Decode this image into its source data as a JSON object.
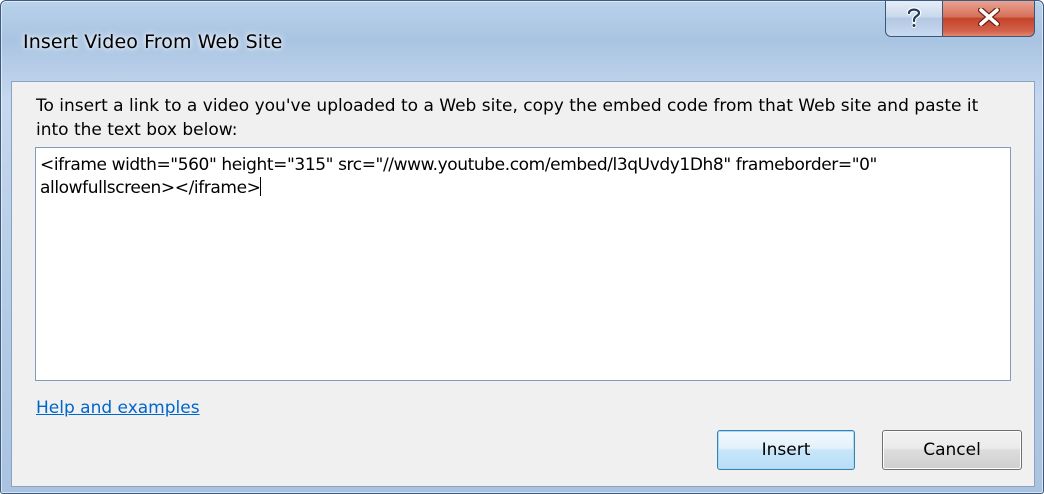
{
  "window": {
    "title": "Insert Video From Web Site",
    "help_button": "?",
    "close_button": "X"
  },
  "dialog": {
    "instructions": "To insert a link to a video you've uploaded to a Web site, copy the embed code from that Web site and paste it into the text box below:",
    "embed_code": "<iframe width=\"560\" height=\"315\" src=\"//www.youtube.com/embed/l3qUvdy1Dh8\" frameborder=\"0\" allowfullscreen></iframe>",
    "help_link": "Help and examples",
    "insert_button": "Insert",
    "cancel_button": "Cancel"
  }
}
